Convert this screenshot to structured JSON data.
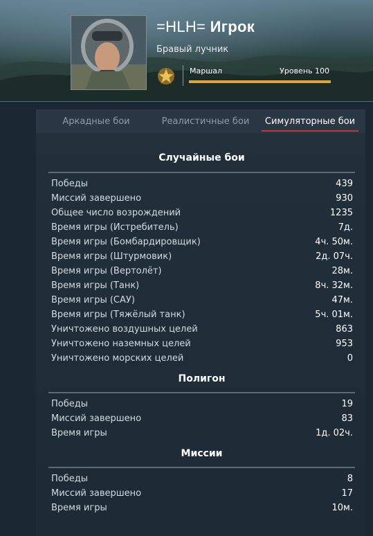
{
  "profile": {
    "clan_tag": "=HLH=",
    "name": "Игрок",
    "title": "Бравый лучник",
    "rank": "Маршал",
    "level": "Уровень 100",
    "progress": 1.0
  },
  "tabs": [
    {
      "label": "Аркадные бои",
      "active": false
    },
    {
      "label": "Реалистичные бои",
      "active": false
    },
    {
      "label": "Симуляторные бои",
      "active": true
    }
  ],
  "sections": [
    {
      "title": "Случайные бои",
      "rows": [
        {
          "label": "Победы",
          "value": "439"
        },
        {
          "label": "Миссий завершено",
          "value": "930"
        },
        {
          "label": "Общее число возрождений",
          "value": "1235"
        },
        {
          "label": "Время игры (Истребитель)",
          "value": "7д."
        },
        {
          "label": "Время игры (Бомбардировщик)",
          "value": "4ч. 50м."
        },
        {
          "label": "Время игры (Штурмовик)",
          "value": "2д. 07ч."
        },
        {
          "label": "Время игры (Вертолёт)",
          "value": "28м."
        },
        {
          "label": "Время игры (Танк)",
          "value": "8ч. 32м."
        },
        {
          "label": "Время игры (САУ)",
          "value": "47м."
        },
        {
          "label": "Время игры (Тяжёлый танк)",
          "value": "5ч. 01м."
        },
        {
          "label": "Уничтожено воздушных целей",
          "value": "863"
        },
        {
          "label": "Уничтожено наземных целей",
          "value": "953"
        },
        {
          "label": "Уничтожено морских целей",
          "value": "0"
        }
      ]
    },
    {
      "title": "Полигон",
      "rows": [
        {
          "label": "Победы",
          "value": "19"
        },
        {
          "label": "Миссий завершено",
          "value": "83"
        },
        {
          "label": "Время игры",
          "value": "1д. 02ч."
        }
      ]
    },
    {
      "title": "Миссии",
      "rows": [
        {
          "label": "Победы",
          "value": "8"
        },
        {
          "label": "Миссий завершено",
          "value": "17"
        },
        {
          "label": "Время игры",
          "value": "10м."
        }
      ]
    }
  ],
  "colors": {
    "accent_tab": "#c0392b",
    "progress": "#e2a53a"
  }
}
